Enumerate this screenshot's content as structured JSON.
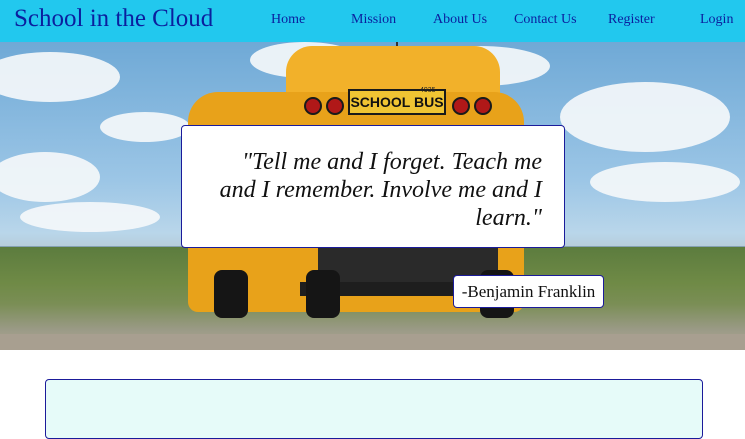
{
  "nav": {
    "brand": "School in the Cloud",
    "links": [
      "Home",
      "Mission",
      "About Us",
      "Contact Us",
      "Register",
      "Login"
    ]
  },
  "hero": {
    "bus_sign": "SCHOOL BUS",
    "bus_number": "4935",
    "quote": "\"Tell me and I forget. Teach me and I remember. Involve me and I learn.\"",
    "author": "-Benjamin Franklin"
  },
  "colors": {
    "nav_bg": "#22c8ee",
    "nav_text": "#0b1f9e",
    "panel_bg": "#e6fbf9",
    "border": "#1b1b9a"
  }
}
